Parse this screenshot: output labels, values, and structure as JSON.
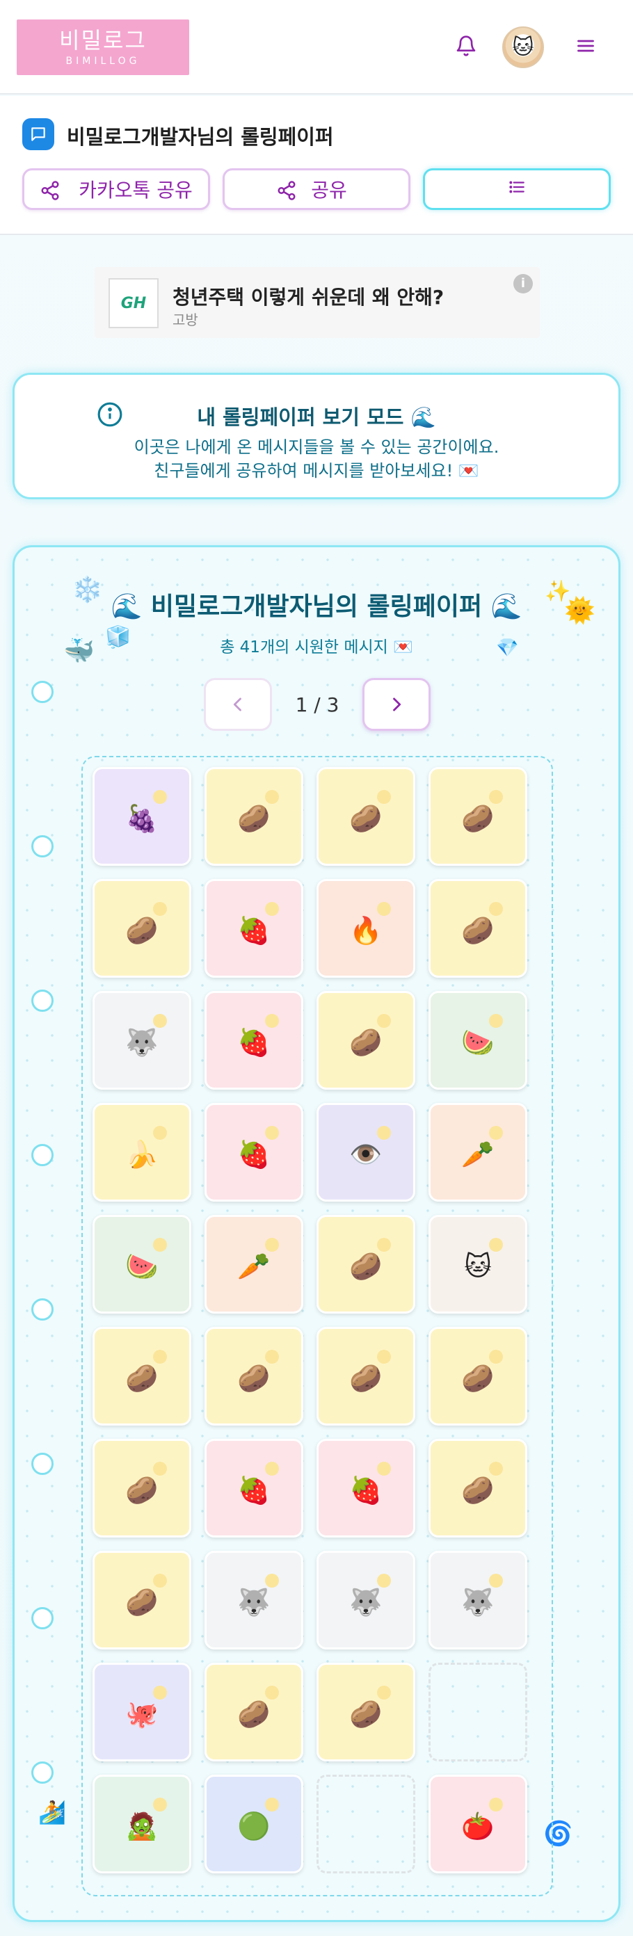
{
  "header": {
    "logo_korean": "비밀로그",
    "logo_english": "BIMILLOG",
    "icons": [
      "bell-icon",
      "avatar",
      "menu-icon"
    ]
  },
  "title": {
    "text": "비밀로그개발자님의 롤링페이퍼",
    "buttons": {
      "kakao_share": "카카오톡 공유",
      "share": "공유",
      "list_icon": "list-icon"
    }
  },
  "ad": {
    "logo": "GH",
    "title": "청년주택 이렇게 쉬운데 왜 안해?",
    "sub": "고방",
    "info": "i"
  },
  "info_card": {
    "title": "내 롤링페이퍼 보기 모드 🌊",
    "line1": "이곳은 나에게 온 메시지들을 볼 수 있는 공간이에요.",
    "line2": "친구들에게 공유하여 메시지를 받아보세요! 💌"
  },
  "board": {
    "title": "🌊 비밀로그개발자님의 롤링페이퍼 🌊",
    "subtitle": "총 41개의 시원한 메시지 💌",
    "pager": {
      "text": "1 / 3",
      "prev_icon": "chevron-left-icon",
      "next_icon": "chevron-right-icon"
    },
    "decorations": {
      "snowflake": "❄️",
      "whale": "🐳",
      "cube": "🧊",
      "sparkle": "✨",
      "sun": "🌞",
      "gem": "💎",
      "surfer": "🏄",
      "swirl": "🌀"
    },
    "rows": [
      [
        {
          "emoji": "🍇",
          "color": "#ece4fb"
        },
        {
          "emoji": "🥔",
          "color": "#fdf4c4"
        },
        {
          "emoji": "🥔",
          "color": "#fdf4c4"
        },
        {
          "emoji": "🥔",
          "color": "#fdf4c4"
        }
      ],
      [
        {
          "emoji": "🥔",
          "color": "#fdf4c4"
        },
        {
          "emoji": "🍓",
          "color": "#fde4e8"
        },
        {
          "emoji": "🔥",
          "color": "#fde6dc"
        },
        {
          "emoji": "🥔",
          "color": "#fdf4c4"
        }
      ],
      [
        {
          "emoji": "🐺",
          "color": "#f2f4f6"
        },
        {
          "emoji": "🍓",
          "color": "#fde4e8"
        },
        {
          "emoji": "🥔",
          "color": "#fdf4c4"
        },
        {
          "emoji": "🍉",
          "color": "#e6f3e6"
        }
      ],
      [
        {
          "emoji": "🍌",
          "color": "#fdf4c4"
        },
        {
          "emoji": "🍓",
          "color": "#fde4e8"
        },
        {
          "emoji": "👁️",
          "color": "#e8e4f8"
        },
        {
          "emoji": "🥕",
          "color": "#fde8dc"
        }
      ],
      [
        {
          "emoji": "🍉",
          "color": "#e6f3e6"
        },
        {
          "emoji": "🥕",
          "color": "#fde8dc"
        },
        {
          "emoji": "🥔",
          "color": "#fdf4c4"
        },
        {
          "emoji": "🐱",
          "color": "#f7f1ec"
        }
      ],
      [
        {
          "emoji": "🥔",
          "color": "#fdf4c4"
        },
        {
          "emoji": "🥔",
          "color": "#fdf4c4"
        },
        {
          "emoji": "🥔",
          "color": "#fdf4c4"
        },
        {
          "emoji": "🥔",
          "color": "#fdf4c4"
        }
      ],
      [
        {
          "emoji": "🥔",
          "color": "#fdf4c4"
        },
        {
          "emoji": "🍓",
          "color": "#fde4e8"
        },
        {
          "emoji": "🍓",
          "color": "#fde4e8"
        },
        {
          "emoji": "🥔",
          "color": "#fdf4c4"
        }
      ],
      [
        {
          "emoji": "🥔",
          "color": "#fdf4c4"
        },
        {
          "emoji": "🐺",
          "color": "#f2f4f6"
        },
        {
          "emoji": "🐺",
          "color": "#f2f4f6"
        },
        {
          "emoji": "🐺",
          "color": "#f2f4f6"
        }
      ],
      [
        {
          "emoji": "🐙",
          "color": "#e6e6fb"
        },
        {
          "emoji": "🥔",
          "color": "#fdf4c4"
        },
        {
          "emoji": "🥔",
          "color": "#fdf4c4"
        },
        {
          "emoji": "",
          "color": ""
        }
      ],
      [
        {
          "emoji": "🧟",
          "color": "#e4f4ea"
        },
        {
          "emoji": "🟢",
          "color": "#dde6fb"
        },
        {
          "emoji": "",
          "color": ""
        },
        {
          "emoji": "🍅",
          "color": "#fde4e8"
        }
      ]
    ]
  },
  "colors": {
    "accent_purple": "#8e24aa",
    "accent_cyan": "#5fe0f0",
    "logo_pink": "#f4a6cf",
    "chat_blue": "#1e88e5"
  }
}
